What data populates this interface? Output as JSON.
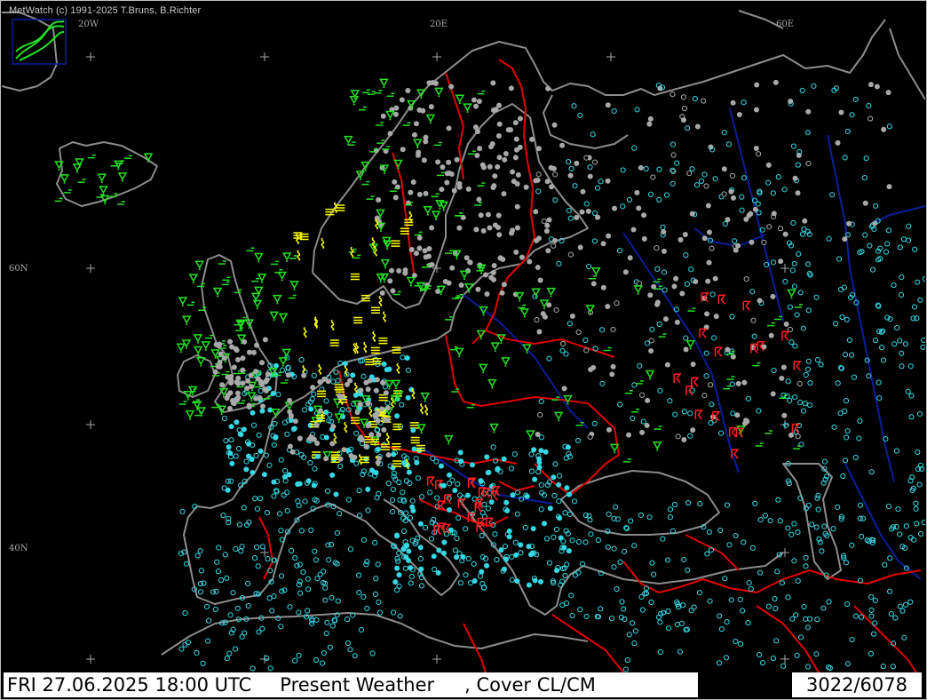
{
  "app": {
    "copyright": "MetWatch  (c) 1991-2025 T.Bruns, B.Richter"
  },
  "grid_labels": {
    "lon_20w": "20W",
    "lon_20e": "20E",
    "lon_60e": "60E",
    "lat_60n": "60N",
    "lat_40n": "40N"
  },
  "status": {
    "datetime": "FRI 27.06.2025 18:00 UTC",
    "parameter": "Present Weather",
    "cover": ", Cover CL/CM",
    "count": "3022/6078"
  },
  "colors": {
    "background": "#000000",
    "coastline": "#8c8c8c",
    "borders": "#e00000",
    "rivers": "#0a1e9a",
    "station_clear": "#34d8e4",
    "station_overcast": "#a8a8a8",
    "rain": "#22e022",
    "thunder": "#ff2020",
    "fog_haze": "#ffff00"
  },
  "icons": [
    "logo-icon",
    "station-plot-icon",
    "rain-shower-icon",
    "thunderstorm-icon",
    "fog-icon",
    "haze-icon"
  ]
}
